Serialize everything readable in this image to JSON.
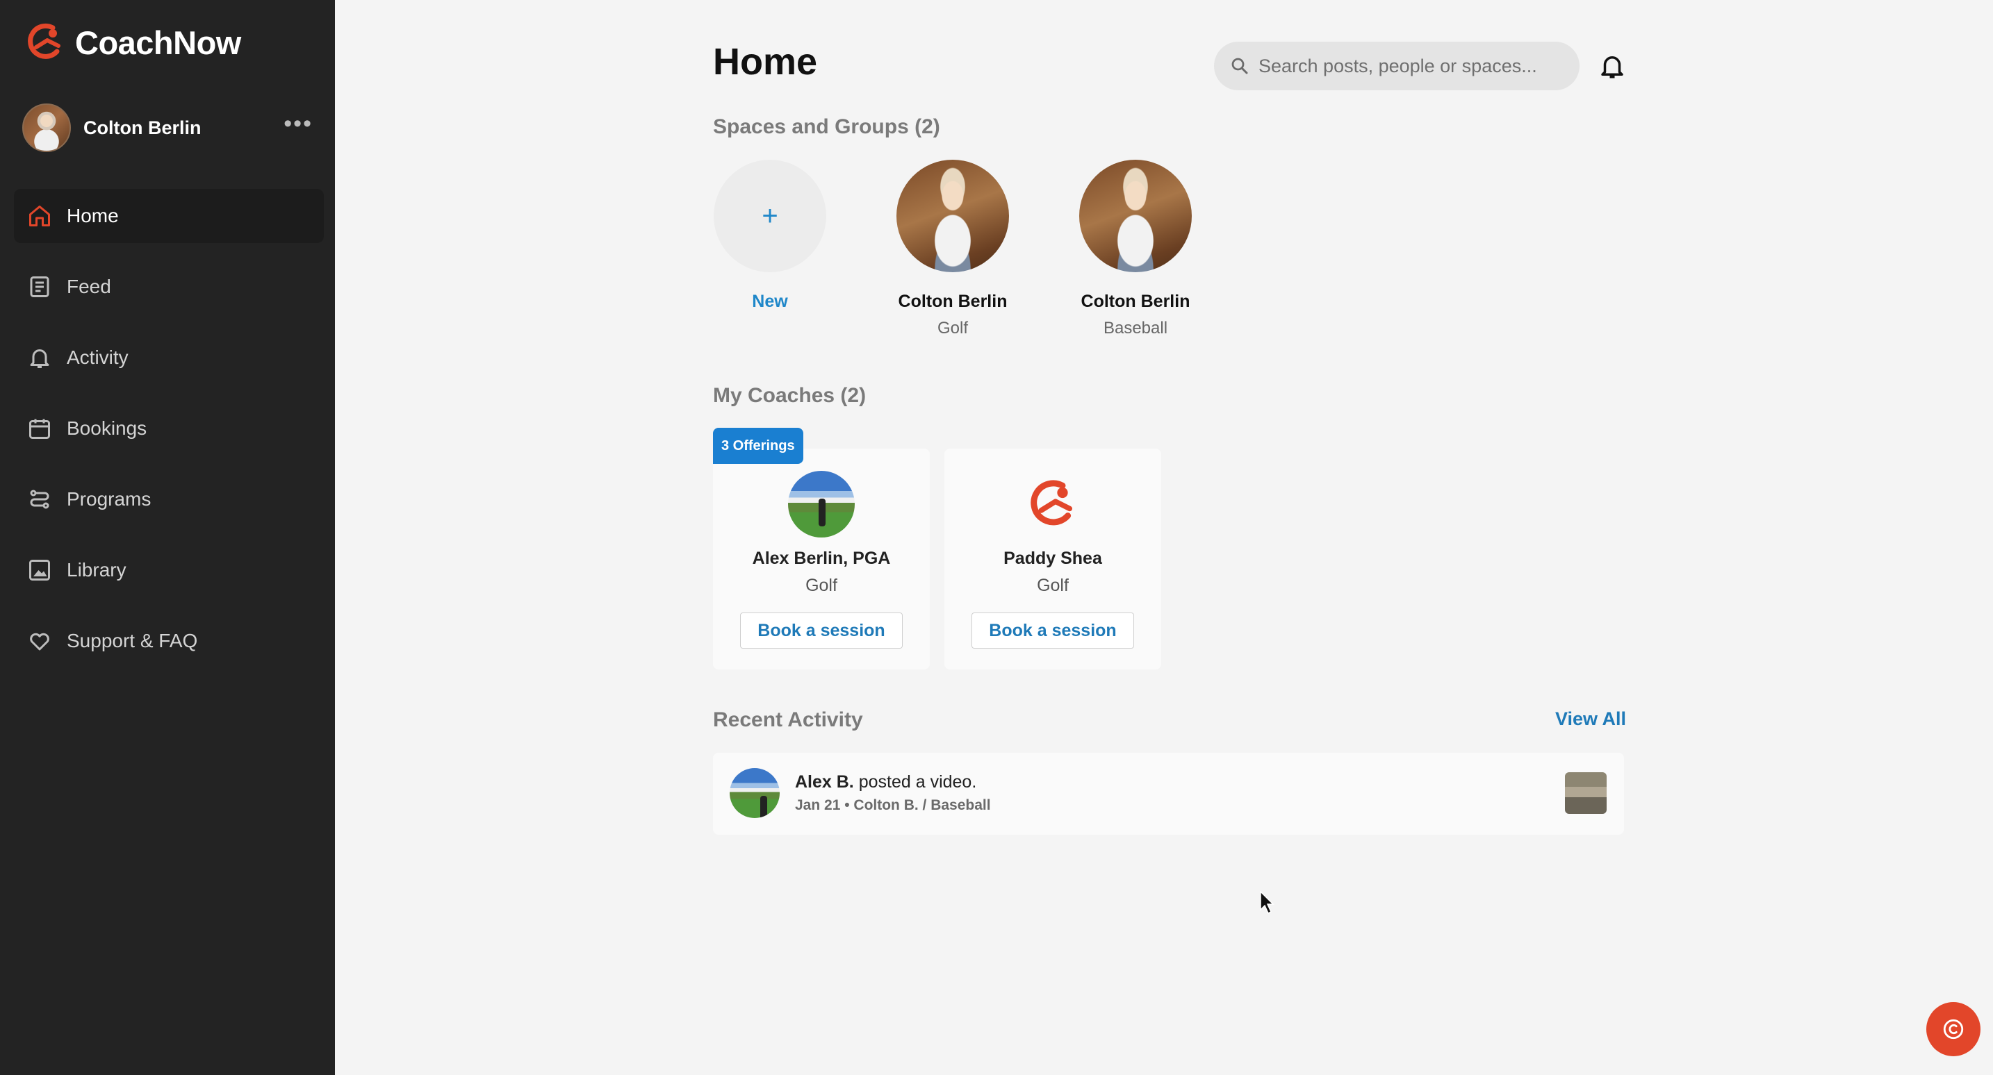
{
  "brand": {
    "name": "CoachNow",
    "accent": "#e2462a"
  },
  "profile": {
    "name": "Colton Berlin",
    "menu": "•••"
  },
  "nav": [
    {
      "label": "Home",
      "icon": "home-icon",
      "active": true
    },
    {
      "label": "Feed",
      "icon": "feed-icon"
    },
    {
      "label": "Activity",
      "icon": "bell-icon"
    },
    {
      "label": "Bookings",
      "icon": "calendar-icon"
    },
    {
      "label": "Programs",
      "icon": "programs-icon"
    },
    {
      "label": "Library",
      "icon": "image-icon"
    },
    {
      "label": "Support & FAQ",
      "icon": "heart-icon"
    }
  ],
  "header": {
    "title": "Home",
    "search_placeholder": "Search posts, people or spaces..."
  },
  "spaces": {
    "title": "Spaces and Groups (2)",
    "new_label": "New",
    "items": [
      {
        "name": "Colton Berlin",
        "sport": "Golf"
      },
      {
        "name": "Colton Berlin",
        "sport": "Baseball"
      }
    ]
  },
  "coaches": {
    "title": "My Coaches (2)",
    "items": [
      {
        "badge": "3 Offerings",
        "name": "Alex Berlin, PGA",
        "sport": "Golf",
        "button": "Book a session"
      },
      {
        "name": "Paddy Shea",
        "sport": "Golf",
        "button": "Book a session"
      }
    ]
  },
  "activity": {
    "title": "Recent Activity",
    "view_all": "View All",
    "items": [
      {
        "actor": "Alex B.",
        "action": " posted a video.",
        "meta": "Jan 21 • Colton B. / Baseball"
      }
    ]
  },
  "colors": {
    "link_blue": "#1f7ab8",
    "sidebar_bg": "#232323",
    "page_bg": "#f4f4f4",
    "badge_blue": "#1a7fd1"
  }
}
